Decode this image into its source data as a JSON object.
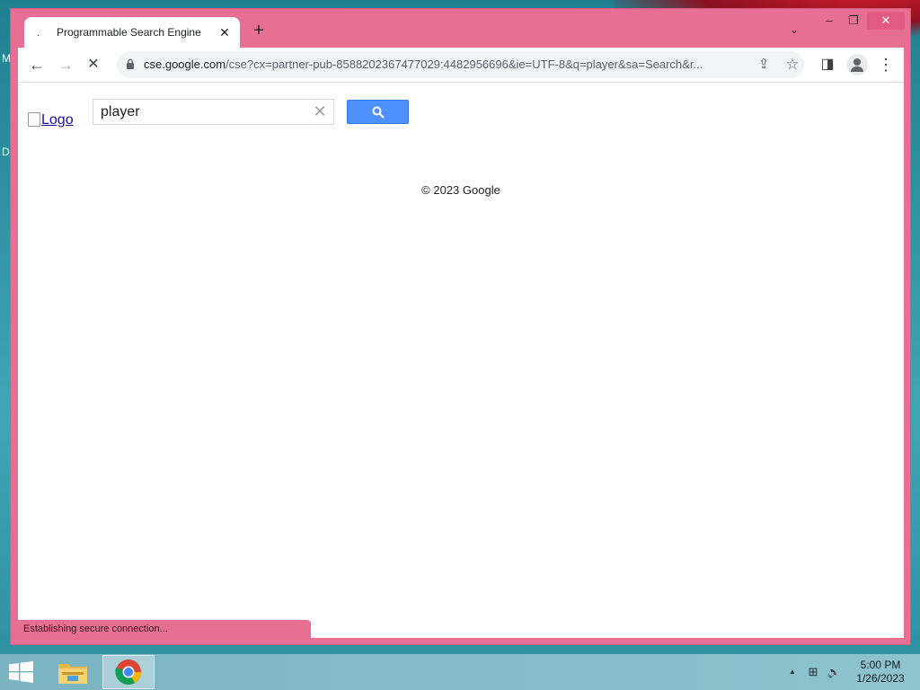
{
  "desktop": {
    "edge_letters": [
      "M",
      "D"
    ]
  },
  "browser": {
    "tab": {
      "favicon": ".",
      "title": "Programmable Search Engine",
      "close_glyph": "✕"
    },
    "new_tab_glyph": "+",
    "tab_search_glyph": "⌄",
    "window_controls": {
      "minimize": "–",
      "maximize": "❐",
      "close": "✕"
    },
    "toolbar": {
      "back_glyph": "←",
      "forward_glyph": "→",
      "stop_glyph": "✕",
      "url_host": "cse.google.com",
      "url_rest": "/cse?cx=partner-pub-8588202367477029:4482956696&ie=UTF-8&q=player&sa=Search&r...",
      "share_glyph": "⇪",
      "bookmark_glyph": "☆",
      "side_panel_glyph": "◨",
      "menu_glyph": "⋮"
    },
    "status_text": "Establishing secure connection..."
  },
  "page": {
    "logo_alt": "Logo",
    "search": {
      "value": "player",
      "clear_glyph": "✕"
    },
    "copyright": "© 2023 Google"
  },
  "taskbar": {
    "apps": [
      "file-explorer",
      "chrome"
    ],
    "tray": {
      "up_glyph": "▲",
      "network_glyph": "⊞",
      "volume_glyph": "🔈"
    },
    "clock": {
      "time": "5:00 PM",
      "date": "1/26/2023"
    }
  },
  "colors": {
    "window_frame": "#e86f94",
    "search_button": "#4d90fe",
    "link": "#1a0dab"
  }
}
